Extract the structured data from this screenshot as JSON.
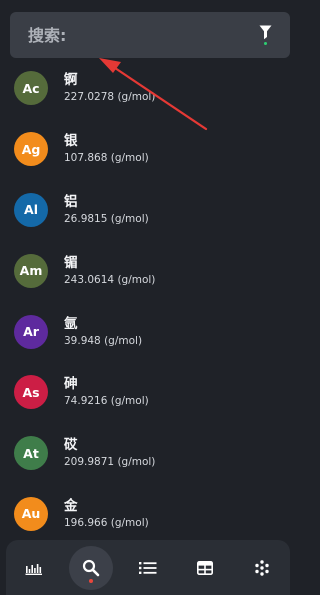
{
  "search": {
    "placeholder": "搜索:",
    "value": ""
  },
  "colors": {
    "background": "#1f2228",
    "search_bar": "#3a3e46",
    "filter_indicator": "#2dcf72",
    "active_tab_indicator": "#e8473c",
    "annotation_arrow": "#e53935"
  },
  "elements": [
    {
      "symbol": "Ac",
      "name": "锕",
      "mass": "227.0278 (g/mol)",
      "color": "#556b3b"
    },
    {
      "symbol": "Ag",
      "name": "银",
      "mass": "107.868 (g/mol)",
      "color": "#f28c1c"
    },
    {
      "symbol": "Al",
      "name": "铝",
      "mass": "26.9815 (g/mol)",
      "color": "#1469a8"
    },
    {
      "symbol": "Am",
      "name": "镅",
      "mass": "243.0614 (g/mol)",
      "color": "#556b3b"
    },
    {
      "symbol": "Ar",
      "name": "氩",
      "mass": "39.948 (g/mol)",
      "color": "#5e2a9e"
    },
    {
      "symbol": "As",
      "name": "砷",
      "mass": "74.9216 (g/mol)",
      "color": "#cc1e45"
    },
    {
      "symbol": "At",
      "name": "砹",
      "mass": "209.9871 (g/mol)",
      "color": "#3f7d4a"
    },
    {
      "symbol": "Au",
      "name": "金",
      "mass": "196.966 (g/mol)",
      "color": "#f28c1c"
    }
  ],
  "bottom_nav": {
    "items": [
      {
        "icon": "histogram-icon",
        "active": false
      },
      {
        "icon": "search-icon",
        "active": true
      },
      {
        "icon": "list-icon",
        "active": false
      },
      {
        "icon": "table-icon",
        "active": false
      },
      {
        "icon": "dots-grid-icon",
        "active": false
      }
    ]
  }
}
